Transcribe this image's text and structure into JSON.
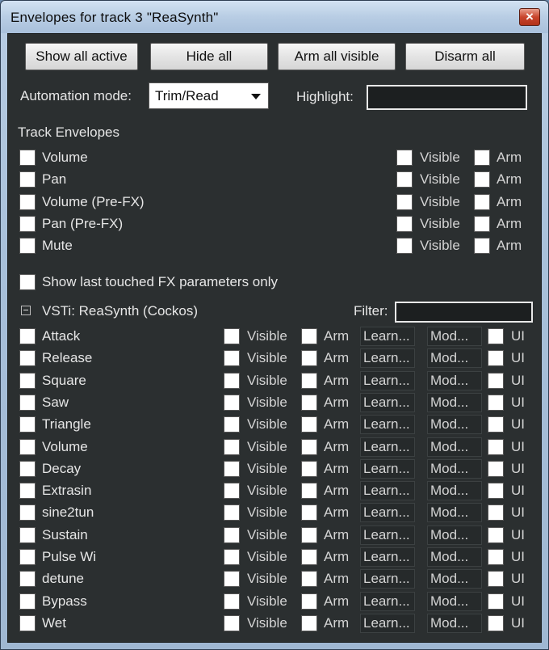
{
  "window": {
    "title": "Envelopes for track 3 \"ReaSynth\"",
    "close_glyph": "×"
  },
  "toolbar": {
    "show_all_active": "Show all active",
    "hide_all": "Hide all",
    "arm_all_visible": "Arm all visible",
    "disarm_all": "Disarm all"
  },
  "automation": {
    "label": "Automation mode:",
    "value": "Trim/Read"
  },
  "highlight": {
    "label": "Highlight:",
    "value": ""
  },
  "track_envelopes": {
    "heading": "Track Envelopes",
    "items": [
      {
        "label": "Volume",
        "visible": "Visible",
        "arm": "Arm"
      },
      {
        "label": "Pan",
        "visible": "Visible",
        "arm": "Arm"
      },
      {
        "label": "Volume (Pre-FX)",
        "visible": "Visible",
        "arm": "Arm"
      },
      {
        "label": "Pan (Pre-FX)",
        "visible": "Visible",
        "arm": "Arm"
      },
      {
        "label": "Mute",
        "visible": "Visible",
        "arm": "Arm"
      }
    ]
  },
  "show_last_touched": {
    "label": "Show last touched FX parameters only"
  },
  "fx": {
    "name": "VSTi: ReaSynth (Cockos)",
    "filter_label": "Filter:",
    "filter_value": "",
    "visible_label": "Visible",
    "arm_label": "Arm",
    "learn_label": "Learn...",
    "mod_label": "Mod...",
    "ui_label": "UI",
    "params": [
      "Attack",
      "Release",
      "Square",
      "Saw",
      "Triangle",
      "Volume",
      "Decay",
      "Extrasin",
      "sine2tun",
      "Sustain",
      "Pulse Wi",
      "detune",
      "Bypass",
      "Wet"
    ]
  },
  "colors": {
    "panel_bg": "#2b2f30",
    "text": "#e6e6e6",
    "close_button": "#c9452d"
  }
}
